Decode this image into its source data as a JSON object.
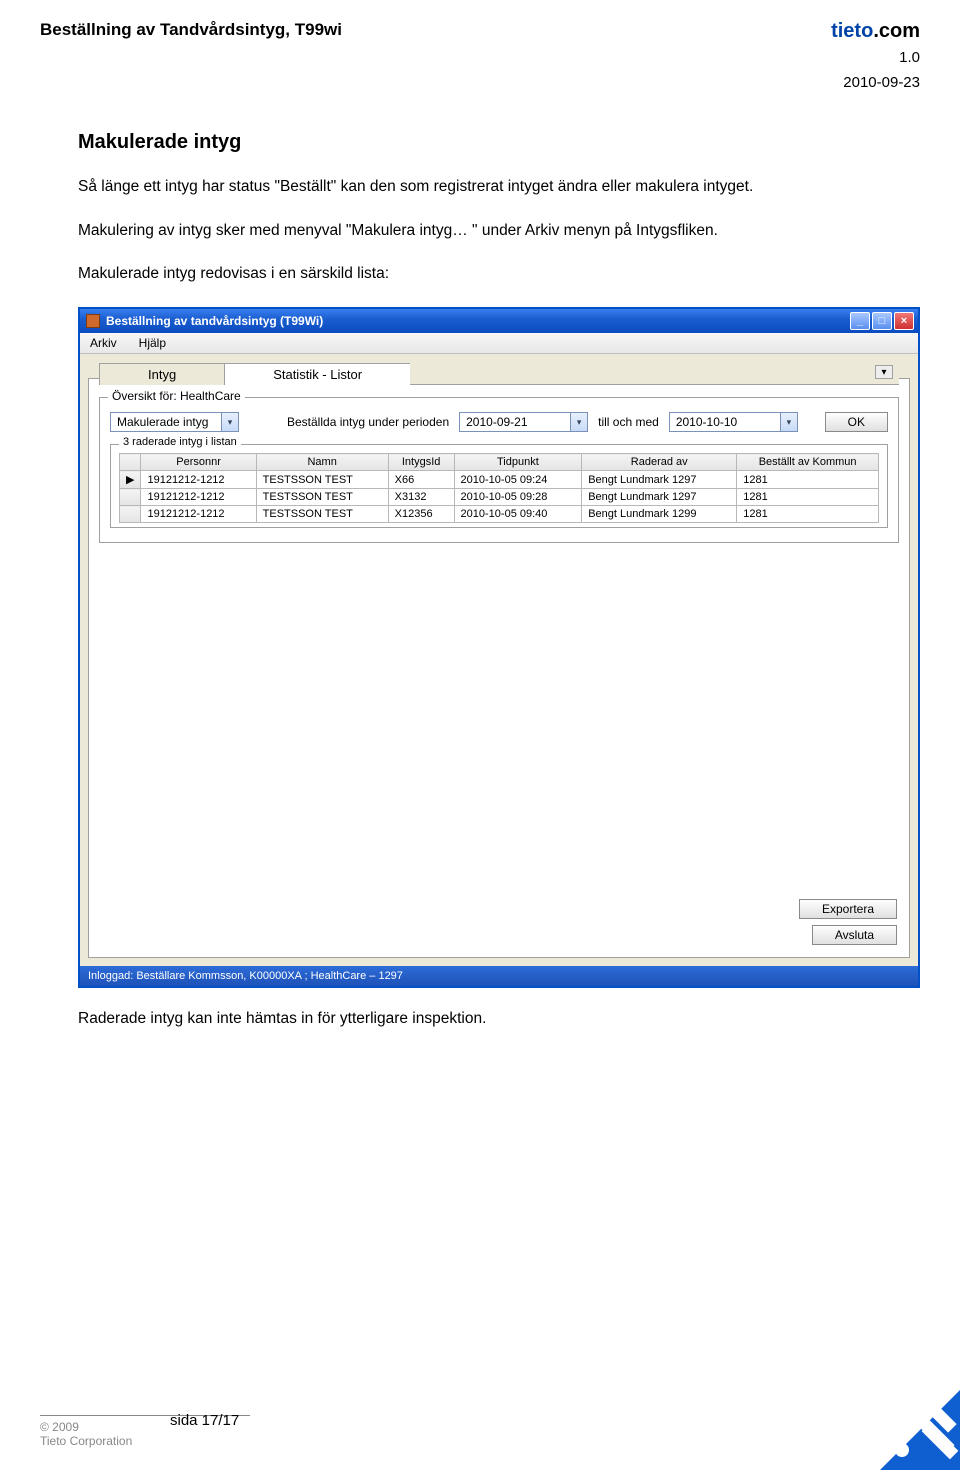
{
  "header": {
    "doc_title": "Beställning av Tandvårdsintyg, T99wi",
    "logo_text_blue": "tieto",
    "logo_text_black": ".com",
    "version": "1.0",
    "date": "2010-09-23"
  },
  "body": {
    "heading": "Makulerade intyg",
    "p1": "Så länge ett intyg har status \"Beställt\" kan den som registrerat intyget ändra eller makulera intyget.",
    "p2": "Makulering av intyg sker med menyval \"Makulera intyg… \" under Arkiv menyn på Intygsfliken.",
    "p3": "Makulerade intyg redovisas i en särskild lista:",
    "p4": "Raderade intyg kan inte hämtas in för ytterligare inspektion."
  },
  "window": {
    "title": "Beställning av tandvårdsintyg (T99Wi)",
    "min": "_",
    "max": "□",
    "close": "×",
    "menu": {
      "m1": "Arkiv",
      "m2": "Hjälp"
    },
    "tabs": {
      "t_intyg": "Intyg",
      "t_stat": "Statistik - Listor"
    },
    "overview_label": "Översikt för: HealthCare",
    "filter": {
      "combo": "Makulerade intyg",
      "period_label": "Beställda intyg under perioden",
      "date_from": "2010-09-21",
      "between": "till och med",
      "date_to": "2010-10-10",
      "ok": "OK"
    },
    "inner_legend": "3 raderade intyg i listan",
    "columns": {
      "c0": "",
      "c1": "Personnr",
      "c2": "Namn",
      "c3": "IntygsId",
      "c4": "Tidpunkt",
      "c5": "Raderad av",
      "c6": "Beställt av Kommun"
    },
    "rows": [
      {
        "m": "▶",
        "c1": "19121212-1212",
        "c2": "TESTSSON TEST",
        "c3": "X66",
        "c4": "2010-10-05 09:24",
        "c5": "Bengt Lundmark 1297",
        "c6": "1281"
      },
      {
        "m": "",
        "c1": "19121212-1212",
        "c2": "TESTSSON TEST",
        "c3": "X3132",
        "c4": "2010-10-05 09:28",
        "c5": "Bengt Lundmark 1297",
        "c6": "1281"
      },
      {
        "m": "",
        "c1": "19121212-1212",
        "c2": "TESTSSON TEST",
        "c3": "X12356",
        "c4": "2010-10-05 09:40",
        "c5": "Bengt Lundmark 1299",
        "c6": "1281"
      }
    ],
    "export": "Exportera",
    "close_btn": "Avsluta",
    "status": "Inloggad:  Beställare Kommsson, K00000XA ; HealthCare – 1297"
  },
  "footer": {
    "pagenum": "sida 17/17",
    "cr1": "© 2009",
    "cr2": "Tieto Corporation"
  }
}
